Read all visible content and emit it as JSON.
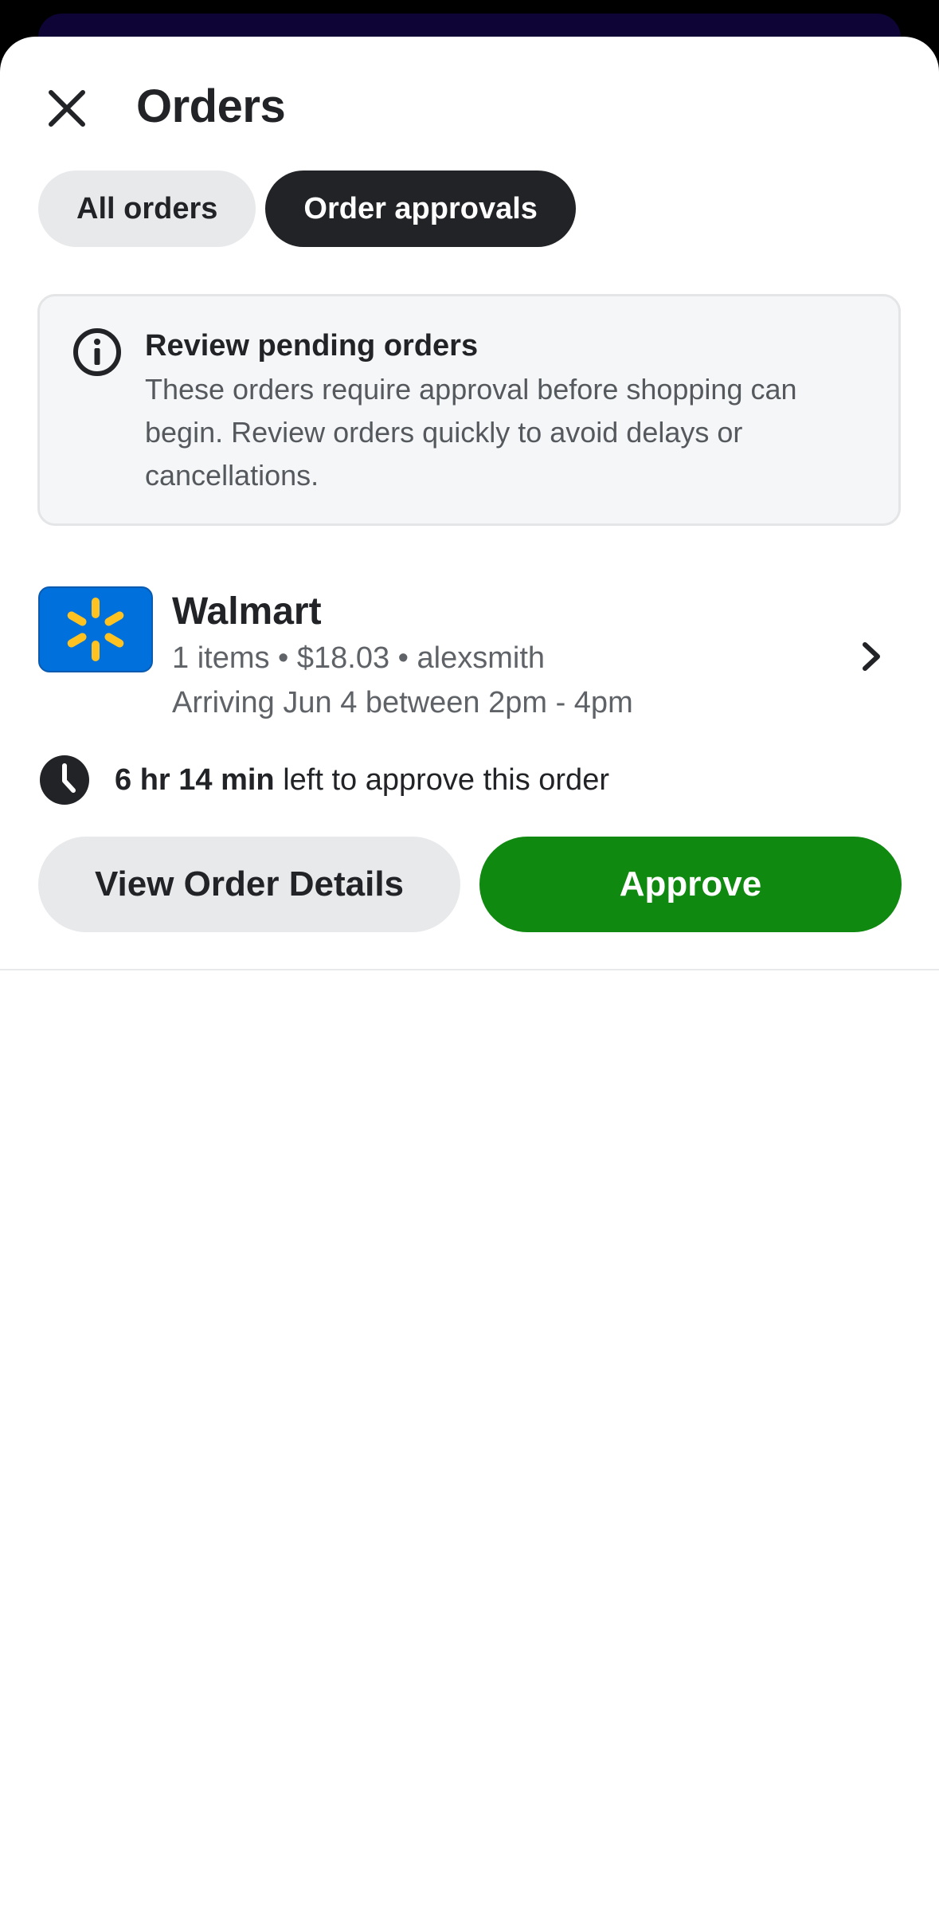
{
  "header": {
    "title": "Orders",
    "close_icon": "close-icon"
  },
  "tabs": [
    {
      "label": "All orders",
      "active": false
    },
    {
      "label": "Order approvals",
      "active": true
    }
  ],
  "notice": {
    "icon": "info-icon",
    "title": "Review pending orders",
    "body": "These orders require approval before shopping can begin. Review orders quickly to avoid delays or cancellations."
  },
  "order": {
    "store_name": "Walmart",
    "store_logo": "walmart-spark-logo",
    "meta": "1 items • $18.03 • alexsmith",
    "arrival": "Arriving Jun 4 between 2pm - 4pm",
    "timer_bold": "6 hr 14 min",
    "timer_rest": " left to approve this order",
    "details_label": "View Order Details",
    "approve_label": "Approve"
  },
  "colors": {
    "accent_green": "#108910",
    "dark": "#222326",
    "walmart_blue": "#0071dc",
    "walmart_yellow": "#ffc220",
    "backdrop_navy": "#0e0536"
  }
}
